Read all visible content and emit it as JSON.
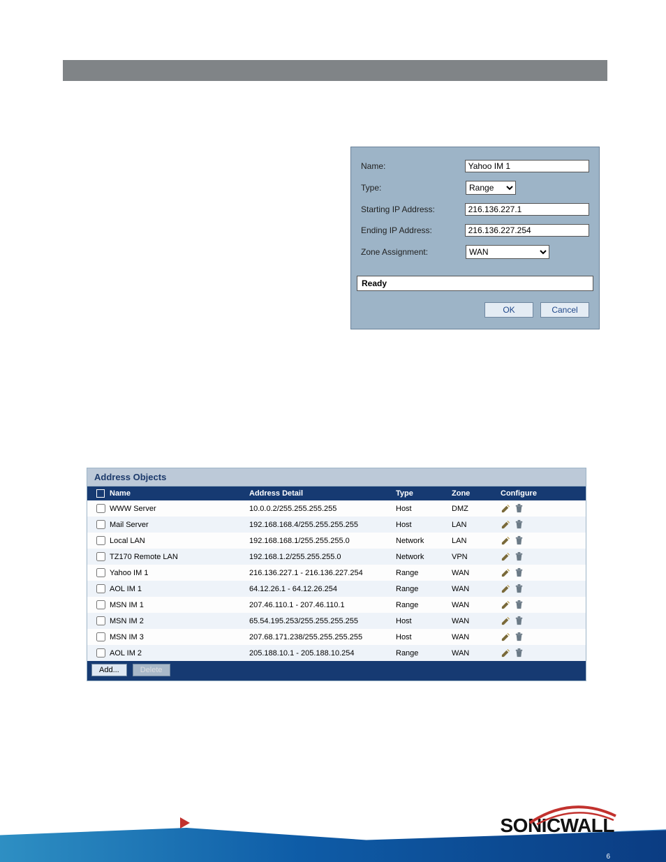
{
  "top_number": "",
  "dialog": {
    "fields": {
      "name": {
        "label": "Name:",
        "value": "Yahoo IM 1"
      },
      "type": {
        "label": "Type:",
        "value": "Range"
      },
      "start": {
        "label": "Starting IP Address:",
        "value": "216.136.227.1"
      },
      "end": {
        "label": "Ending IP Address:",
        "value": "216.136.227.254"
      },
      "zone": {
        "label": "Zone Assignment:",
        "value": "WAN"
      }
    },
    "status": "Ready",
    "buttons": {
      "ok": "OK",
      "cancel": "Cancel"
    }
  },
  "panel": {
    "title": "Address Objects",
    "columns": {
      "name": "Name",
      "detail": "Address Detail",
      "type": "Type",
      "zone": "Zone",
      "configure": "Configure"
    },
    "rows": [
      {
        "name": "WWW Server",
        "detail": "10.0.0.2/255.255.255.255",
        "type": "Host",
        "zone": "DMZ"
      },
      {
        "name": "Mail Server",
        "detail": "192.168.168.4/255.255.255.255",
        "type": "Host",
        "zone": "LAN"
      },
      {
        "name": "Local LAN",
        "detail": "192.168.168.1/255.255.255.0",
        "type": "Network",
        "zone": "LAN"
      },
      {
        "name": "TZ170 Remote LAN",
        "detail": "192.168.1.2/255.255.255.0",
        "type": "Network",
        "zone": "VPN"
      },
      {
        "name": "Yahoo IM 1",
        "detail": "216.136.227.1 - 216.136.227.254",
        "type": "Range",
        "zone": "WAN"
      },
      {
        "name": "AOL IM 1",
        "detail": "64.12.26.1 - 64.12.26.254",
        "type": "Range",
        "zone": "WAN"
      },
      {
        "name": "MSN IM 1",
        "detail": "207.46.110.1 - 207.46.110.1",
        "type": "Range",
        "zone": "WAN"
      },
      {
        "name": "MSN IM 2",
        "detail": "65.54.195.253/255.255.255.255",
        "type": "Host",
        "zone": "WAN"
      },
      {
        "name": "MSN IM 3",
        "detail": "207.68.171.238/255.255.255.255",
        "type": "Host",
        "zone": "WAN"
      },
      {
        "name": "AOL IM 2",
        "detail": "205.188.10.1 - 205.188.10.254",
        "type": "Range",
        "zone": "WAN"
      }
    ],
    "footer": {
      "add": "Add...",
      "delete": "Delete"
    }
  },
  "logo_text": "SONICWALL",
  "page_number": "6"
}
